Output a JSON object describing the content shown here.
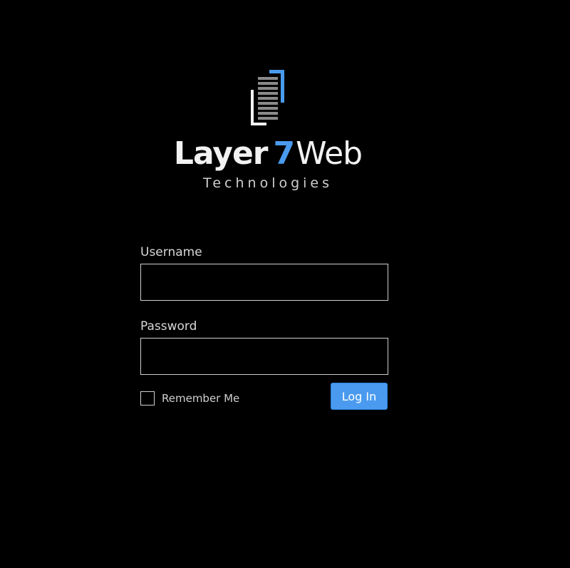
{
  "brand": {
    "wordmark_part1": "Layer",
    "wordmark_part2": "7",
    "wordmark_part3": "Web",
    "tagline": "Technologies",
    "accent_color": "#4a9bef"
  },
  "login_form": {
    "username_label": "Username",
    "username_value": "",
    "password_label": "Password",
    "password_value": "",
    "remember_label": "Remember Me",
    "remember_checked": false,
    "submit_label": "Log In"
  }
}
